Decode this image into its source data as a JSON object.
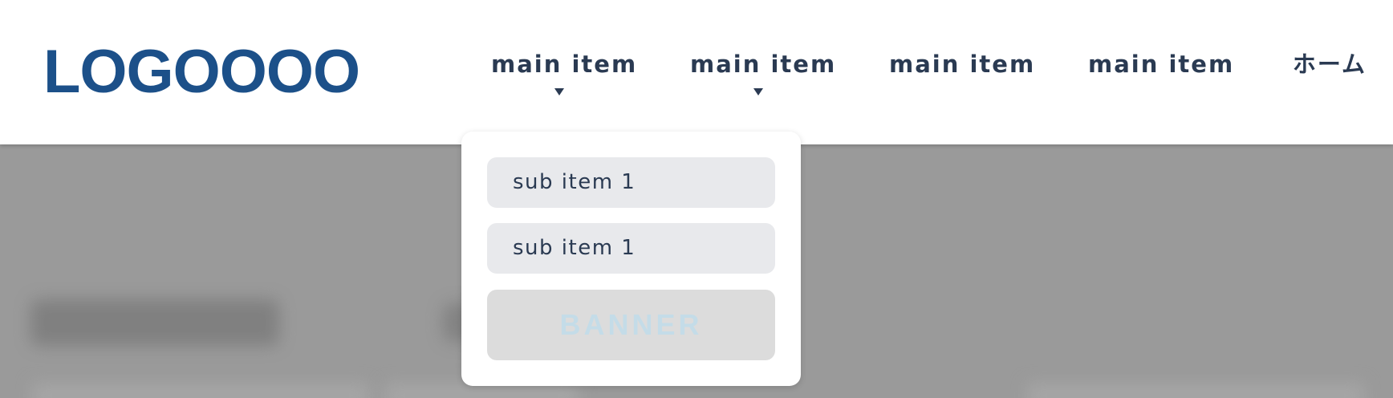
{
  "header": {
    "logo": "LOGOOOO",
    "nav": [
      {
        "label": "main item",
        "has_dropdown": true
      },
      {
        "label": "main item",
        "has_dropdown": true
      },
      {
        "label": "main item",
        "has_dropdown": false
      },
      {
        "label": "main item",
        "has_dropdown": false
      },
      {
        "label": "ホーム",
        "has_dropdown": false
      }
    ]
  },
  "dropdown": {
    "items": [
      {
        "label": "sub item 1"
      },
      {
        "label": "sub item 1"
      }
    ],
    "banner": "BANNER"
  },
  "colors": {
    "logo": "#1c5089",
    "nav_text": "#2a3a52",
    "overlay": "#9a9a9a",
    "sub_item_bg": "#e8e9ec",
    "banner_bg": "#dcdcdc",
    "banner_text": "#c4dce8"
  }
}
